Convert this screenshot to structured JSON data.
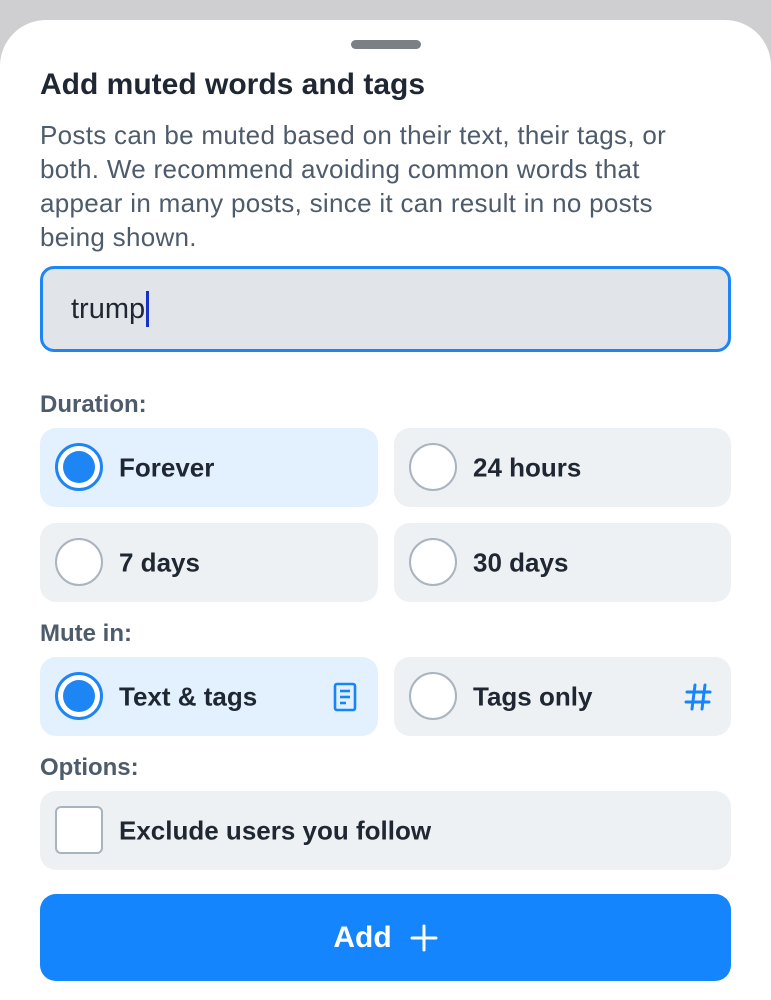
{
  "dialog": {
    "title": "Add muted words and tags",
    "description": "Posts can be muted based on their text, their tags, or both. We recommend avoiding common words that appear in many posts, since it can result in no posts being shown."
  },
  "input": {
    "value": "trump"
  },
  "duration": {
    "label": "Duration:",
    "options": [
      {
        "label": "Forever",
        "selected": true
      },
      {
        "label": "24 hours",
        "selected": false
      },
      {
        "label": "7 days",
        "selected": false
      },
      {
        "label": "30 days",
        "selected": false
      }
    ]
  },
  "mute_in": {
    "label": "Mute in:",
    "options": [
      {
        "label": "Text & tags",
        "selected": true,
        "icon": "document-icon"
      },
      {
        "label": "Tags only",
        "selected": false,
        "icon": "hashtag-icon"
      }
    ]
  },
  "options": {
    "label": "Options:",
    "exclude_following": {
      "label": "Exclude users you follow",
      "checked": false
    }
  },
  "add_button": {
    "label": "Add",
    "icon": "plus-icon"
  },
  "colors": {
    "accent": "#1585fd",
    "selected_bg": "#e3f0fd",
    "option_bg": "#eef1f3",
    "text": "#1f2733",
    "muted_text": "#4d5b6b"
  }
}
